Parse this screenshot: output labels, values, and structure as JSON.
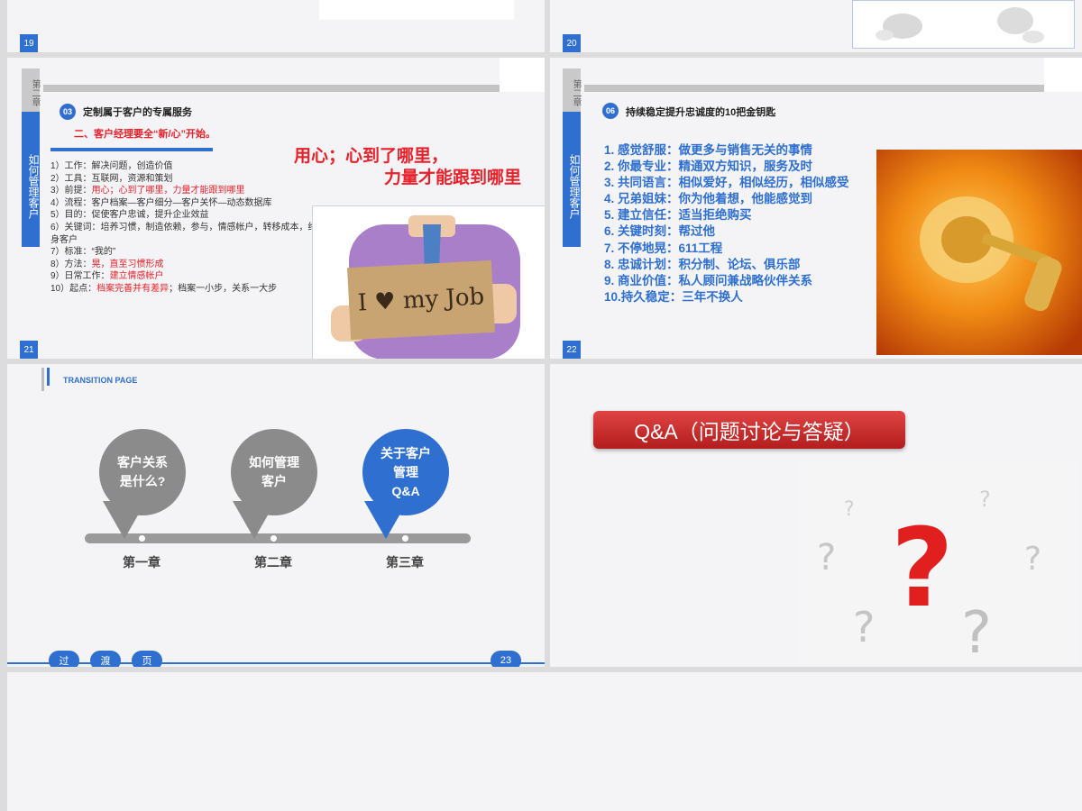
{
  "slides": {
    "s19": {
      "page": "19"
    },
    "s20": {
      "page": "20"
    },
    "s21": {
      "page": "21",
      "chapter_top": "第二章",
      "chapter_bottom": "如何管理客户",
      "section_num": "03",
      "section_title": "定制属于客户的专属服务",
      "subtitle": "二、客户经理要全“新/心”开始。",
      "slogan_line1": "用心；心到了哪里，",
      "slogan_line2": "力量才能跟到哪里",
      "items": [
        {
          "prefix": "1）工作：解决问题，创造价值",
          "red": "",
          "suffix": ""
        },
        {
          "prefix": "2）工具：互联网，资源和策划",
          "red": "",
          "suffix": ""
        },
        {
          "prefix": "3）前提：",
          "red": "用心；心到了哪里，力量才能跟到哪里",
          "suffix": ""
        },
        {
          "prefix": "4）流程：客户档案—客户细分—客户关怀—动态数据库",
          "red": "",
          "suffix": ""
        },
        {
          "prefix": "5）目的：促使客户忠诚，提升企业效益",
          "red": "",
          "suffix": ""
        },
        {
          "prefix": "6）关键词：培养习惯，制造依赖，参与，情感帐户，转移成本，终身客户",
          "red": "",
          "suffix": ""
        },
        {
          "prefix": "7）标准：“我的”",
          "red": "",
          "suffix": ""
        },
        {
          "prefix": "8）方法：",
          "red": "晃，直至习惯形成",
          "suffix": ""
        },
        {
          "prefix": "9）日常工作：",
          "red": "建立情感帐户",
          "suffix": ""
        },
        {
          "prefix": "10）起点：",
          "red": "档案完善并有差异",
          "suffix": "；档案一小步，关系一大步"
        }
      ],
      "sign_text": "I ♥ my Job"
    },
    "s22": {
      "page": "22",
      "chapter_top": "第二章",
      "chapter_bottom": "如何管理客户",
      "section_num": "06",
      "section_title": "持续稳定提升忠诚度的10把金钥匙",
      "items": [
        "1.  感觉舒服：做更多与销售无关的事情",
        "2.  你最专业：精通双方知识，服务及时",
        "3.  共同语言：相似爱好，相似经历，相似感受",
        "4.  兄弟姐妹：你为他着想，他能感觉到",
        "5.  建立信任：适当拒绝购买",
        "6.  关键时刻：帮过他",
        "7.  不停地晃：611工程",
        "8.  忠诚计划：积分制、论坛、俱乐部",
        "9.  商业价值：私人顾问兼战略伙伴关系",
        "10.持久稳定：三年不换人"
      ]
    },
    "s23": {
      "header": "TRANSITION PAGE",
      "pins": [
        {
          "text": "客户关系是什么?",
          "chapter": "第一章"
        },
        {
          "text": "如何管理客户",
          "chapter": "第二章"
        },
        {
          "text": "关于客户管理Q&A",
          "chapter": "第三章"
        }
      ],
      "pin_lines": [
        [
          "客户关系",
          "是什么?"
        ],
        [
          "如何管理",
          "客户"
        ],
        [
          "关于客户",
          "管理",
          "Q&A"
        ]
      ],
      "footer": [
        "过",
        "渡",
        "页"
      ],
      "page": "23"
    },
    "s24": {
      "qa_title": "Q&A（问题讨论与答疑）"
    }
  },
  "colors": {
    "accent": "#2e6fcf",
    "red": "#e8212a",
    "grey_pin": "#8b8b8b"
  }
}
